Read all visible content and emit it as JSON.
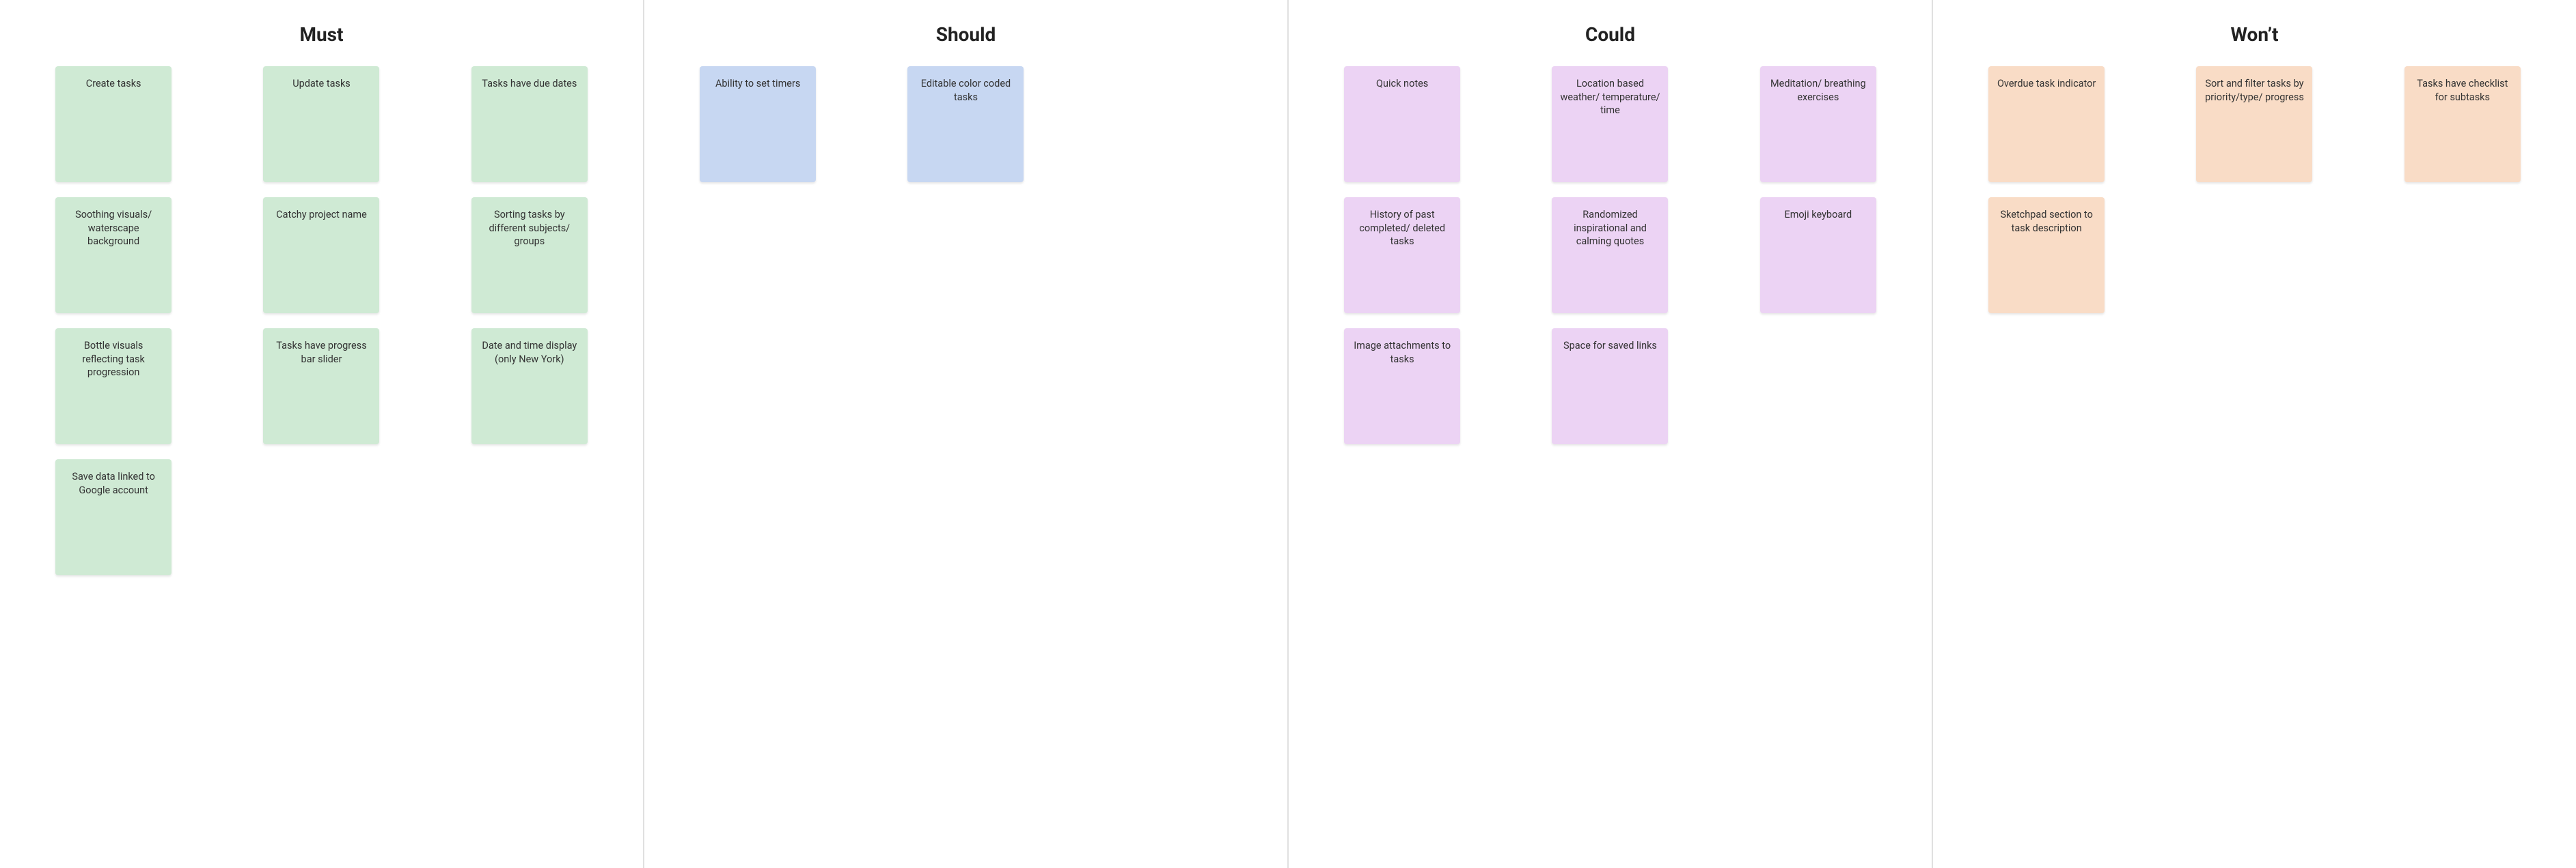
{
  "board": {
    "columns": [
      {
        "id": "must",
        "title": "Must",
        "color_class": "c-must",
        "cards": [
          "Create tasks",
          "Update tasks",
          "Tasks have due dates",
          "Soothing visuals/ waterscape background",
          "Catchy project name",
          "Sorting tasks by different subjects/ groups",
          "Bottle visuals reflecting task progression",
          "Tasks have progress bar slider",
          "Date and time display (only New York)",
          "Save data linked to Google account"
        ]
      },
      {
        "id": "should",
        "title": "Should",
        "color_class": "c-should",
        "cards": [
          "Ability to set timers",
          "Editable color coded tasks"
        ]
      },
      {
        "id": "could",
        "title": "Could",
        "color_class": "c-could",
        "cards": [
          "Quick notes",
          "Location based weather/ temperature/ time",
          "Meditation/ breathing exercises",
          "History of past completed/ deleted tasks",
          "Randomized inspirational and calming quotes",
          "Emoji keyboard",
          "Image attachments to tasks",
          "Space for saved links"
        ]
      },
      {
        "id": "wont",
        "title": "Won’t",
        "color_class": "c-wont",
        "cards": [
          "Overdue task indicator",
          "Sort and filter tasks by priority/type/ progress",
          "Tasks have checklist for subtasks",
          "Sketchpad section to task description"
        ]
      }
    ]
  }
}
